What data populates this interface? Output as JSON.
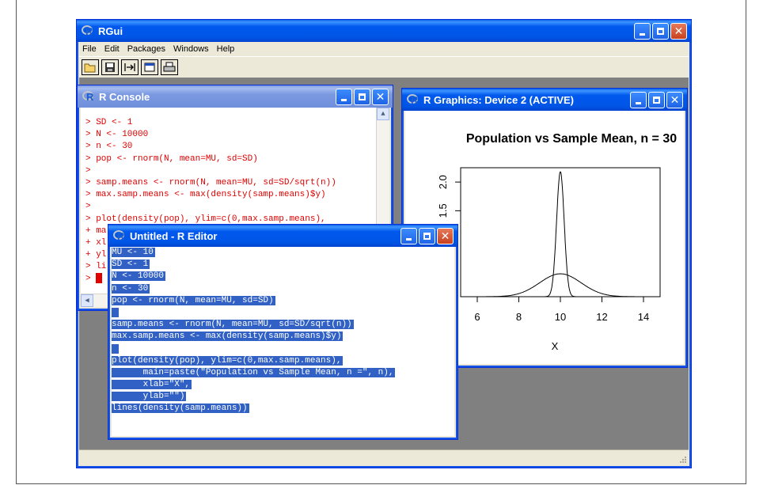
{
  "rgui": {
    "title": "RGui",
    "menu": [
      "File",
      "Edit",
      "Packages",
      "Windows",
      "Help"
    ],
    "toolbar_icons": [
      "open-icon",
      "save-icon",
      "load-workspace-icon",
      "console-icon",
      "print-icon"
    ]
  },
  "console": {
    "title": "R Console",
    "lines": [
      "> SD <- 1",
      "> N <- 10000",
      "> n <- 30",
      "> pop <- rnorm(N, mean=MU, sd=SD)",
      ">",
      "> samp.means <- rnorm(N, mean=MU, sd=SD/sqrt(n))",
      "> max.samp.means <- max(density(samp.means)$y)",
      ">",
      "> plot(density(pop), ylim=c(0,max.samp.means),",
      "+ ma",
      "+ xl",
      "+ yl",
      "> li",
      ">"
    ]
  },
  "graphics": {
    "title": "R Graphics: Device 2 (ACTIVE)",
    "plot_title": "Population vs Sample Mean, n = 30",
    "xlabel": "X"
  },
  "editor": {
    "title": "Untitled - R Editor",
    "lines": [
      "MU <- 10",
      "SD <- 1",
      "N <- 10000",
      "n <- 30",
      "pop <- rnorm(N, mean=MU, sd=SD)",
      " ",
      "samp.means <- rnorm(N, mean=MU, sd=SD/sqrt(n))",
      "max.samp.means <- max(density(samp.means)$y)",
      " ",
      "plot(density(pop), ylim=c(0,max.samp.means),",
      "      main=paste(\"Population vs Sample Mean, n =\", n),",
      "      xlab=\"X\",",
      "      ylab=\"\")",
      "lines(density(samp.means))"
    ]
  },
  "chart_data": {
    "type": "line",
    "title": "Population vs Sample Mean, n = 30",
    "xlabel": "X",
    "ylabel": "",
    "x_ticks": [
      6,
      8,
      10,
      12,
      14
    ],
    "y_ticks": [
      1.5,
      2.0
    ],
    "xlim": [
      5.2,
      14.8
    ],
    "ylim": [
      0,
      2.25
    ],
    "series": [
      {
        "mean": 10,
        "sd": 1,
        "peak": 0.4
      },
      {
        "mean": 10,
        "sd": 0.1826,
        "peak": 2.18
      }
    ]
  }
}
